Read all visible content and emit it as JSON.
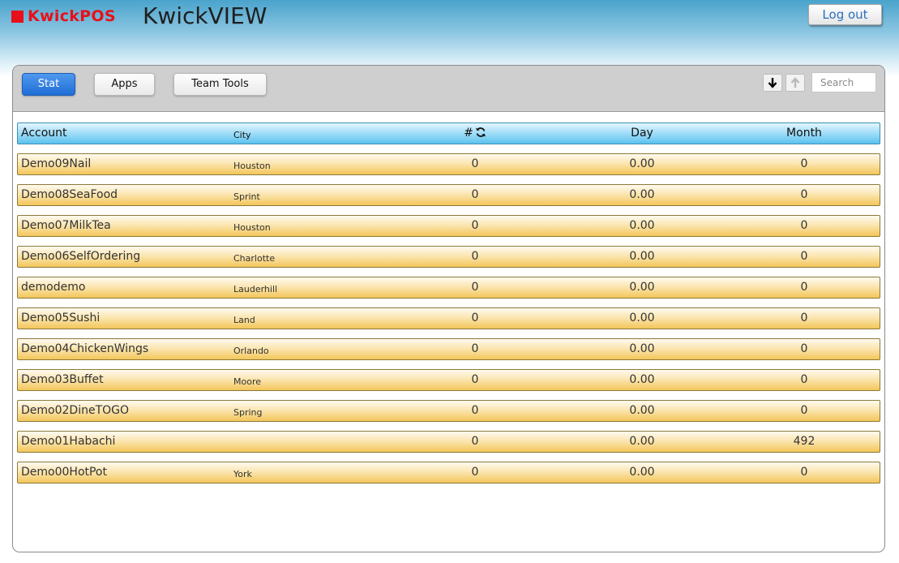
{
  "header": {
    "logo_text": "KwickPOS",
    "app_title": "KwickVIEW",
    "logout_label": "Log out"
  },
  "colors": {
    "brand_red": "#e8101a",
    "active_tab": "#2f7fe0",
    "row_gold": "#f3c65a",
    "header_blue": "#5cc2ef"
  },
  "toolbar": {
    "tabs": [
      {
        "label": "Stat",
        "active": true
      },
      {
        "label": "Apps",
        "active": false
      },
      {
        "label": "Team Tools",
        "active": false
      }
    ],
    "sort_down_icon": "arrow-down-icon",
    "sort_up_icon": "arrow-up-icon",
    "search_placeholder": "Search"
  },
  "table": {
    "columns": {
      "account": "Account",
      "city": "City",
      "num": "#",
      "day": "Day",
      "month": "Month"
    },
    "refresh_icon": "refresh-icon",
    "rows": [
      {
        "account": "Demo09Nail",
        "city": "Houston",
        "num": "0",
        "day": "0.00",
        "month": "0"
      },
      {
        "account": "Demo08SeaFood",
        "city": "Sprint",
        "num": "0",
        "day": "0.00",
        "month": "0"
      },
      {
        "account": "Demo07MilkTea",
        "city": "Houston",
        "num": "0",
        "day": "0.00",
        "month": "0"
      },
      {
        "account": "Demo06SelfOrdering",
        "city": "Charlotte",
        "num": "0",
        "day": "0.00",
        "month": "0"
      },
      {
        "account": "demodemo",
        "city": "Lauderhill",
        "num": "0",
        "day": "0.00",
        "month": "0"
      },
      {
        "account": "Demo05Sushi",
        "city": "Land",
        "num": "0",
        "day": "0.00",
        "month": "0"
      },
      {
        "account": "Demo04ChickenWings",
        "city": "Orlando",
        "num": "0",
        "day": "0.00",
        "month": "0"
      },
      {
        "account": "Demo03Buffet",
        "city": "Moore",
        "num": "0",
        "day": "0.00",
        "month": "0"
      },
      {
        "account": "Demo02DineTOGO",
        "city": "Spring",
        "num": "0",
        "day": "0.00",
        "month": "0"
      },
      {
        "account": "Demo01Habachi",
        "city": "",
        "num": "0",
        "day": "0.00",
        "month": "492"
      },
      {
        "account": "Demo00HotPot",
        "city": "York",
        "num": "0",
        "day": "0.00",
        "month": "0"
      }
    ]
  }
}
